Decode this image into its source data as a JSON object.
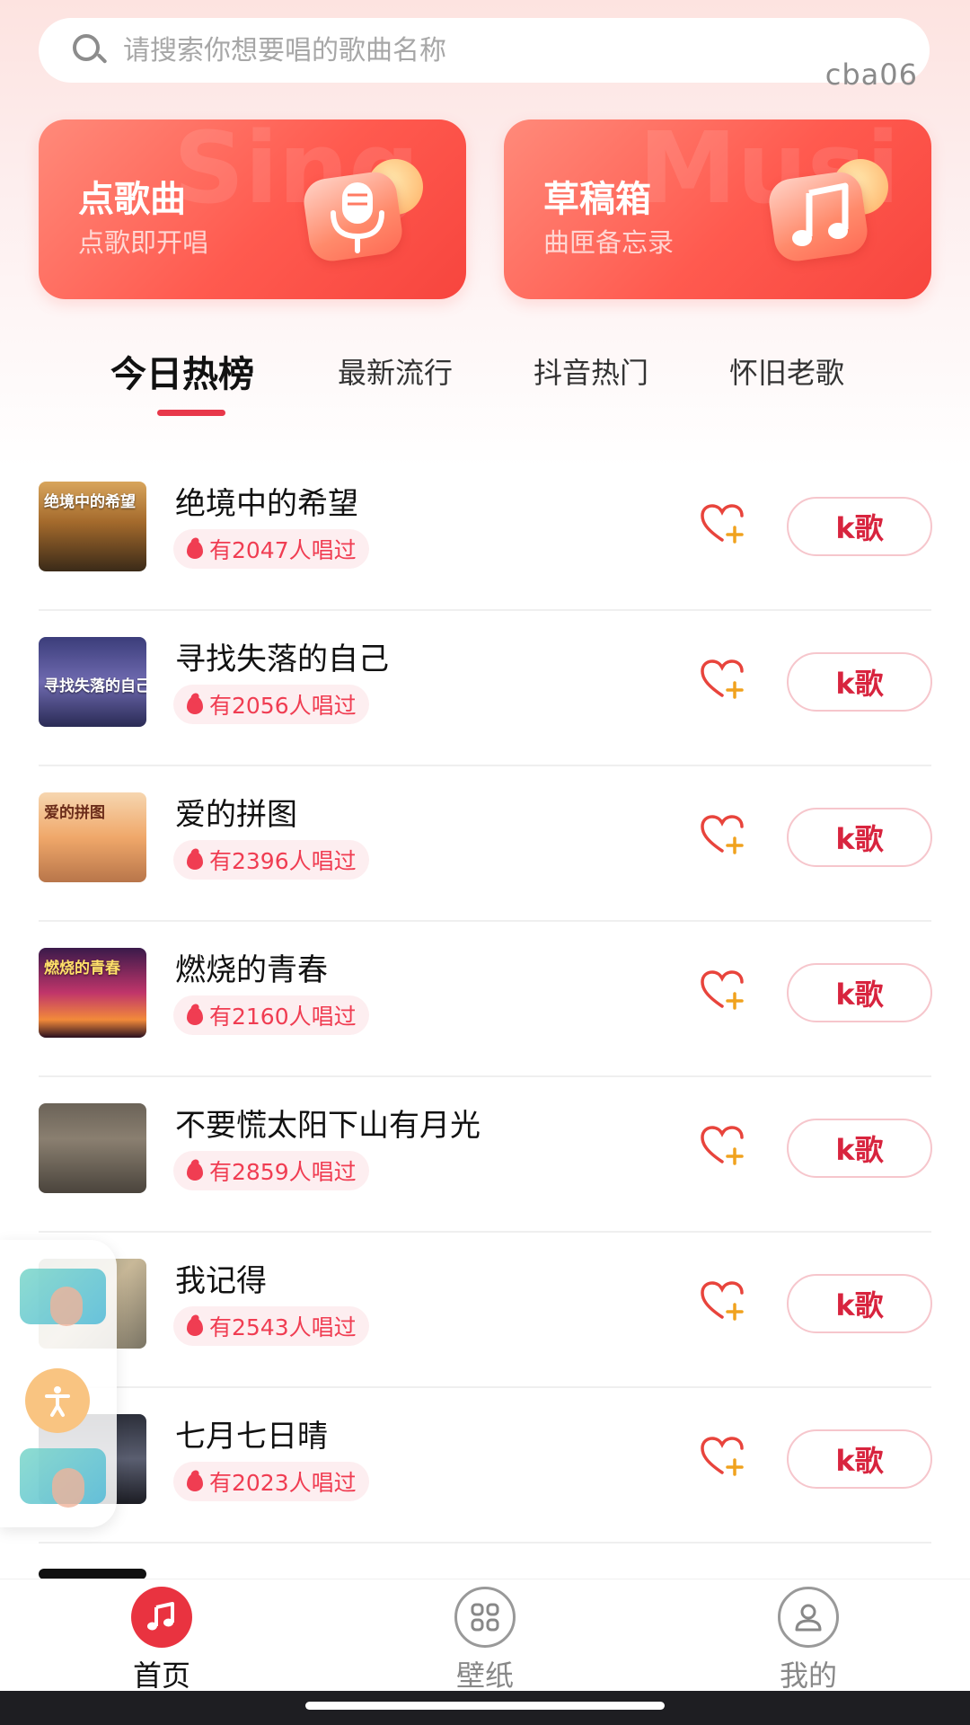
{
  "search": {
    "placeholder": "请搜索你想要唱的歌曲名称"
  },
  "watermark": "cba06",
  "cards": [
    {
      "title": "点歌曲",
      "subtitle": "点歌即开唱",
      "bg_word": "Sing",
      "icon": "microphone-icon"
    },
    {
      "title": "草稿箱",
      "subtitle": "曲匣备忘录",
      "bg_word": "Musi",
      "icon": "music-note-icon"
    }
  ],
  "tabs": [
    {
      "label": "今日热榜",
      "active": true
    },
    {
      "label": "最新流行",
      "active": false
    },
    {
      "label": "抖音热门",
      "active": false
    },
    {
      "label": "怀旧老歌",
      "active": false
    }
  ],
  "songs": [
    {
      "title": "绝境中的希望",
      "sing_count": "有2047人唱过",
      "cover_text": "绝境中的希望",
      "button": "k歌"
    },
    {
      "title": "寻找失落的自己",
      "sing_count": "有2056人唱过",
      "cover_text": "寻找失落的自己",
      "button": "k歌"
    },
    {
      "title": "爱的拼图",
      "sing_count": "有2396人唱过",
      "cover_text": "爱的拼图",
      "button": "k歌"
    },
    {
      "title": "燃烧的青春",
      "sing_count": "有2160人唱过",
      "cover_text": "燃烧的青春",
      "button": "k歌"
    },
    {
      "title": "不要慌太阳下山有月光",
      "sing_count": "有2859人唱过",
      "cover_text": "",
      "button": "k歌"
    },
    {
      "title": "我记得",
      "sing_count": "有2543人唱过",
      "cover_text": "",
      "button": "k歌"
    },
    {
      "title": "七月七日晴",
      "sing_count": "有2023人唱过",
      "cover_text": "",
      "button": "k歌"
    }
  ],
  "nav": [
    {
      "label": "首页",
      "icon": "music-note-icon",
      "active": true
    },
    {
      "label": "壁纸",
      "icon": "grid-icon",
      "active": false
    },
    {
      "label": "我的",
      "icon": "user-icon",
      "active": false
    }
  ],
  "colors": {
    "accent": "#e8384a",
    "card_red": "#ff5a4f",
    "badge_bg": "#fdeef0",
    "badge_text": "#f03d52"
  }
}
